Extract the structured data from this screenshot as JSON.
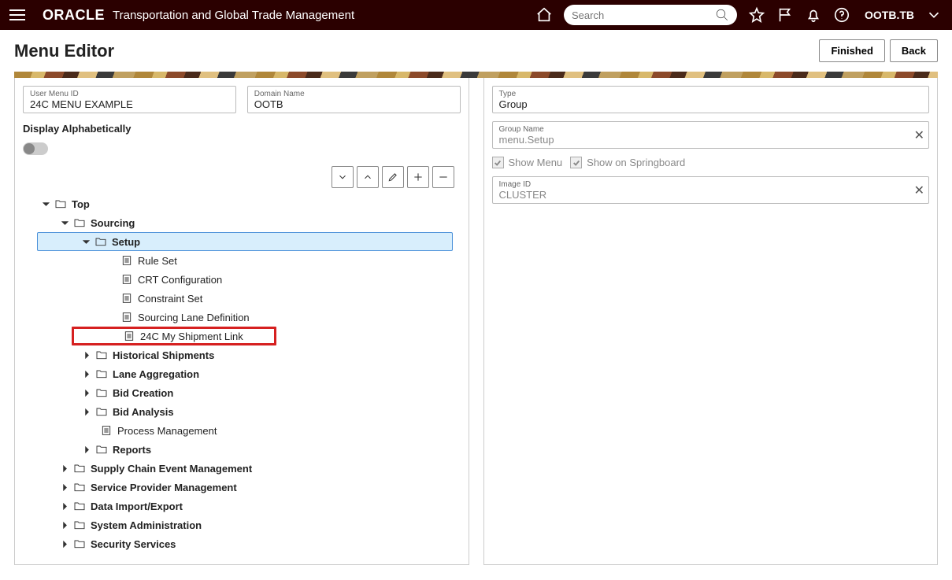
{
  "topbar": {
    "brand": "ORACLE",
    "product": "Transportation and Global Trade Management",
    "search_placeholder": "Search",
    "user": "OOTB.TB"
  },
  "page": {
    "title": "Menu Editor",
    "finished_label": "Finished",
    "back_label": "Back"
  },
  "left": {
    "user_menu_id_label": "User Menu ID",
    "user_menu_id_value": "24C MENU EXAMPLE",
    "domain_name_label": "Domain Name",
    "domain_name_value": "OOTB",
    "display_alpha_label": "Display Alphabetically"
  },
  "tree": {
    "top": "Top",
    "sourcing": "Sourcing",
    "setup": "Setup",
    "rule_set": "Rule Set",
    "crt_config": "CRT Configuration",
    "constraint_set": "Constraint Set",
    "sourcing_lane_def": "Sourcing Lane Definition",
    "my_shipment_link": "24C My Shipment Link",
    "historical_shipments": "Historical Shipments",
    "lane_aggregation": "Lane Aggregation",
    "bid_creation": "Bid Creation",
    "bid_analysis": "Bid Analysis",
    "process_management": "Process Management",
    "reports": "Reports",
    "supply_chain": "Supply Chain Event Management",
    "service_provider": "Service Provider Management",
    "data_import_export": "Data Import/Export",
    "system_admin": "System Administration",
    "security_services": "Security Services"
  },
  "right": {
    "type_label": "Type",
    "type_value": "Group",
    "group_name_label": "Group Name",
    "group_name_value": "menu.Setup",
    "show_menu_label": "Show Menu",
    "show_springboard_label": "Show on Springboard",
    "image_id_label": "Image ID",
    "image_id_value": "CLUSTER"
  }
}
